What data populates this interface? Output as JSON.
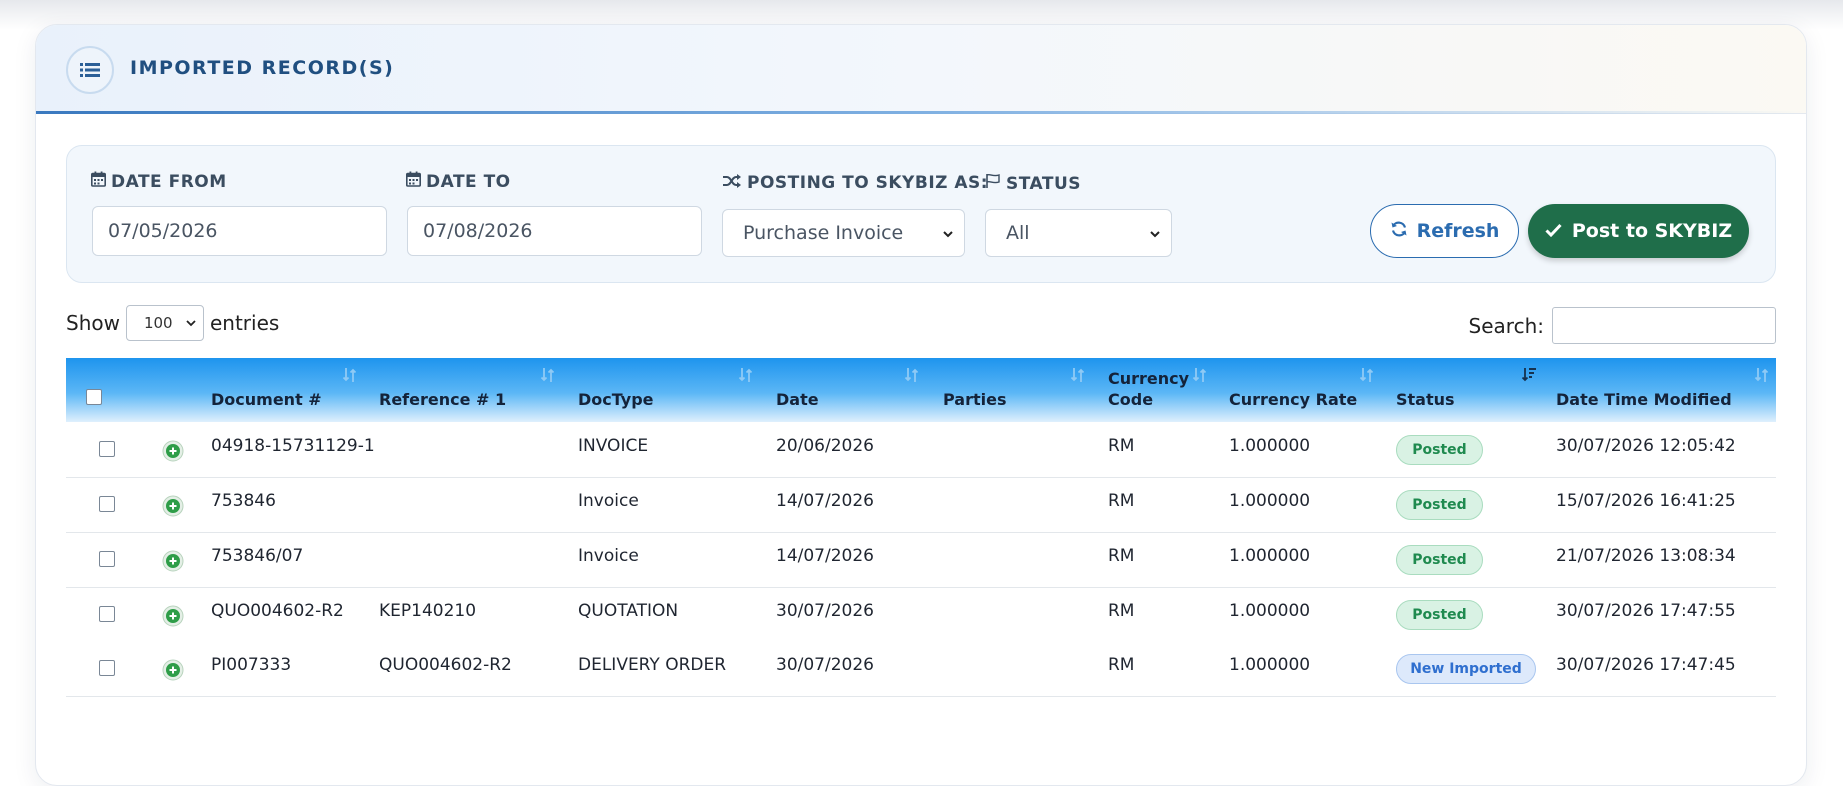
{
  "card": {
    "title": "IMPORTED RECORD(S)"
  },
  "filters": {
    "date_from_label": "DATE FROM",
    "date_from_value": "07/05/2026",
    "date_to_label": "DATE TO",
    "date_to_value": "07/08/2026",
    "posting_label": "POSTING TO SKYBIZ AS:",
    "posting_value": "Purchase Invoice",
    "status_label": "STATUS",
    "status_value": "All",
    "refresh_label": "Refresh",
    "post_label": "Post to SKYBIZ"
  },
  "table_controls": {
    "show_label": "Show",
    "entries_value": "100",
    "entries_label": "entries",
    "search_label": "Search:"
  },
  "columns": [
    "Document #",
    "Reference # 1",
    "DocType",
    "Date",
    "Parties",
    "Currency\nCode",
    "Currency Rate",
    "Status",
    "Date Time Modified"
  ],
  "rows": [
    {
      "document": "04918-15731129-1",
      "reference": "",
      "doctype": "INVOICE",
      "date": "20/06/2026",
      "parties": "",
      "currency_code": "RM",
      "currency_rate": "1.000000",
      "status": "Posted",
      "modified": "30/07/2026 12:05:42"
    },
    {
      "document": "753846",
      "reference": "",
      "doctype": "Invoice",
      "date": "14/07/2026",
      "parties": "",
      "currency_code": "RM",
      "currency_rate": "1.000000",
      "status": "Posted",
      "modified": "15/07/2026 16:41:25"
    },
    {
      "document": "753846/07",
      "reference": "",
      "doctype": "Invoice",
      "date": "14/07/2026",
      "parties": "",
      "currency_code": "RM",
      "currency_rate": "1.000000",
      "status": "Posted",
      "modified": "21/07/2026 13:08:34"
    },
    {
      "document": "QUO004602-R2",
      "reference": "KEP140210",
      "doctype": "QUOTATION",
      "date": "30/07/2026",
      "parties": "",
      "currency_code": "RM",
      "currency_rate": "1.000000",
      "status": "Posted",
      "modified": "30/07/2026 17:47:55"
    },
    {
      "document": "PI007333",
      "reference": "QUO004602-R2",
      "doctype": "DELIVERY ORDER",
      "date": "30/07/2026",
      "parties": "",
      "currency_code": "RM",
      "currency_rate": "1.000000",
      "status": "New Imported",
      "modified": "30/07/2026 17:47:45"
    }
  ],
  "colors": {
    "accent": "#204f80",
    "table_header": "#1e94ee",
    "post_button": "#1f6e4a",
    "posted_badge": "#1f8a4f",
    "new_badge": "#2f6fcf"
  },
  "icons": {
    "header": "list-icon",
    "date_from": "calendar-icon",
    "date_to": "calendar-icon",
    "posting": "shuffle-icon",
    "status": "flag-icon",
    "refresh": "refresh-icon",
    "post": "check-icon",
    "row_expand": "plus-circle-icon"
  }
}
